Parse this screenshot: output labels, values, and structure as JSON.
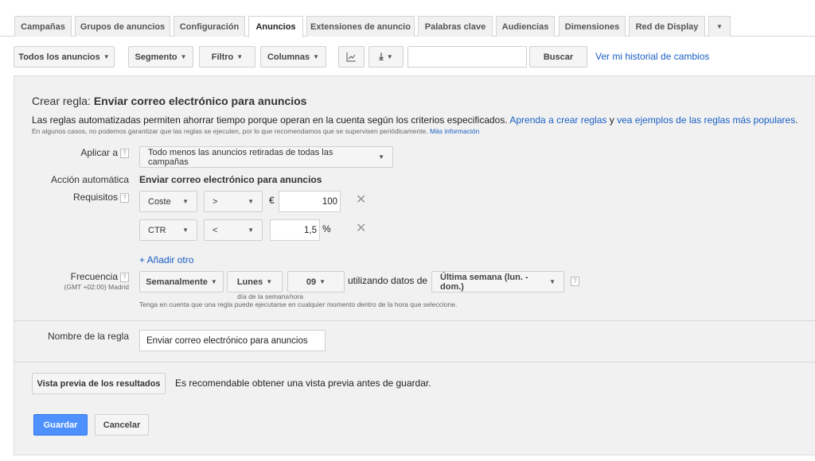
{
  "tabs": [
    "Campañas",
    "Grupos de anuncios",
    "Configuración",
    "Anuncios",
    "Extensiones de anuncio",
    "Palabras clave",
    "Audiencias",
    "Dimensiones",
    "Red de Display"
  ],
  "active_tab": "Anuncios",
  "toolbar": {
    "all_ads": "Todos los anuncios",
    "segment": "Segmento",
    "filter": "Filtro",
    "columns": "Columnas",
    "search_value": "",
    "search_button": "Buscar",
    "history_link": "Ver mi historial de cambios"
  },
  "rule": {
    "title_prefix": "Crear regla:",
    "title_bold": "Enviar correo electrónico para anuncios",
    "desc": "Las reglas automatizadas permiten ahorrar tiempo porque operan en la cuenta según los criterios especificados.",
    "desc_link1": "Aprenda a crear reglas",
    "desc_and": " y ",
    "desc_link2": "vea ejemplos de las reglas más populares",
    "desc_end": ".",
    "note": "En algunos casos, no podemos garantizar que las reglas se ejecuten, por lo que recomendamos que se supervisen periódicamente.",
    "note_link": "Más información",
    "apply_label": "Aplicar a",
    "apply_value": "Todo menos las anuncios retiradas de todas las campañas",
    "action_label": "Acción automática",
    "action_value": "Enviar correo electrónico para anuncios",
    "req_label": "Requisitos",
    "requirements": [
      {
        "metric": "Coste",
        "operator": ">",
        "prefix": "€",
        "value": "100",
        "suffix": ""
      },
      {
        "metric": "CTR",
        "operator": "<",
        "prefix": "",
        "value": "1,5",
        "suffix": "%"
      }
    ],
    "add_other": "+ Añadir otro",
    "freq_label": "Frecuencia",
    "timezone": "(GMT +02:00) Madrid",
    "frequency": "Semanalmente",
    "day": "Lunes",
    "hour": "09",
    "using_data": "utilizando datos de",
    "data_range": "Última semana (lun. - dom.)",
    "day_hint": "día de la semana",
    "hour_hint": "hora",
    "freq_note": "Tenga en cuenta que una regla puede ejecutarse en cualquier momento dentro de la hora que seleccione.",
    "name_label": "Nombre de la regla",
    "name_value": "Enviar correo electrónico para anuncios",
    "preview_button": "Vista previa de los resultados",
    "preview_note": "Es recomendable obtener una vista previa antes de guardar.",
    "save": "Guardar",
    "cancel": "Cancelar"
  },
  "colors": {
    "accent": "#4d90fe",
    "link": "#1a5fc4"
  }
}
